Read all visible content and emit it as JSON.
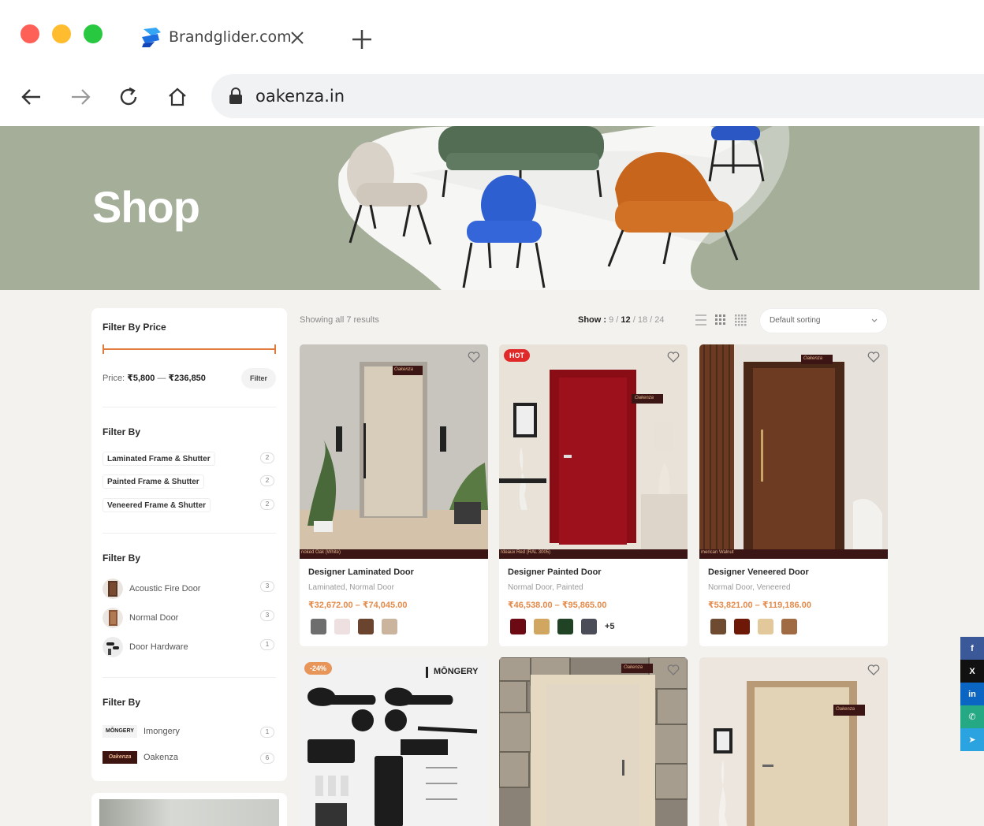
{
  "browser": {
    "tab_title": "Brandglider.com",
    "url": "oakenza.in"
  },
  "hero": {
    "title": "Shop"
  },
  "sidebar": {
    "price_filter": {
      "heading": "Filter By Price",
      "label": "Price:",
      "min": "₹5,800",
      "dash": "—",
      "max": "₹236,850",
      "button": "Filter"
    },
    "category_filter": {
      "heading": "Filter By",
      "items": [
        {
          "label": "Laminated Frame & Shutter",
          "count": "2"
        },
        {
          "label": "Painted Frame & Shutter",
          "count": "2"
        },
        {
          "label": "Veneered Frame & Shutter",
          "count": "2"
        }
      ]
    },
    "type_filter": {
      "heading": "Filter By",
      "items": [
        {
          "label": "Acoustic Fire Door",
          "count": "3"
        },
        {
          "label": "Normal Door",
          "count": "3"
        },
        {
          "label": "Door Hardware",
          "count": "1"
        }
      ]
    },
    "brand_filter": {
      "heading": "Filter By",
      "items": [
        {
          "label": "Imongery",
          "logo_text": "MŌNGERY",
          "count": "1"
        },
        {
          "label": "Oakenza",
          "logo_text": "Oakenza",
          "count": "6"
        }
      ]
    }
  },
  "toolbar": {
    "result_count": "Showing all 7 results",
    "show_label": "Show :",
    "show_options": [
      "9",
      "12",
      "18",
      "24"
    ],
    "show_active": "12",
    "sorting": "Default sorting"
  },
  "products": [
    {
      "name": "Designer Laminated Door",
      "categories": "Laminated, Normal Door",
      "price_min": "₹32,672.00",
      "price_max": "₹74,045.00",
      "swatches": [
        "#6e6e6e",
        "#eee0e0",
        "#6b4430",
        "#cbb49e"
      ],
      "image_caption": "noked Oak (White)",
      "logo": "Oakenza"
    },
    {
      "name": "Designer Painted Door",
      "categories": "Normal Door, Painted",
      "price_min": "₹46,538.00",
      "price_max": "₹95,865.00",
      "swatches": [
        "#6c0a14",
        "#d1a660",
        "#1f4324",
        "#4a4d58"
      ],
      "more": "+5",
      "badge": "HOT",
      "image_caption": "rdeaux Red (RAL 3005)",
      "logo": "Oakenza"
    },
    {
      "name": "Designer Veneered Door",
      "categories": "Normal Door, Veneered",
      "price_min": "₹53,821.00",
      "price_max": "₹119,186.00",
      "swatches": [
        "#6e4a30",
        "#6e1908",
        "#e2c89a",
        "#a06a42"
      ],
      "image_caption": "merican Walnut",
      "logo": "Oakenza"
    }
  ],
  "products_row2": [
    {
      "badge": "-24%",
      "brand": "MŌNGERY"
    },
    {
      "logo": "Oakenza"
    },
    {
      "logo": "Oakenza"
    }
  ],
  "price_sep": "–",
  "social": [
    {
      "icon": "facebook-icon",
      "glyph": "f",
      "color": "#3b5998"
    },
    {
      "icon": "x-icon",
      "glyph": "X",
      "color": "#111111"
    },
    {
      "icon": "linkedin-icon",
      "glyph": "in",
      "color": "#0a66c2"
    },
    {
      "icon": "whatsapp-icon",
      "glyph": "✆",
      "color": "#25a884"
    },
    {
      "icon": "telegram-icon",
      "glyph": "➤",
      "color": "#2aa3e0"
    }
  ],
  "colors": {
    "accent": "#e07b3c",
    "price": "#e38b4b",
    "hero": "#a5ae98"
  }
}
